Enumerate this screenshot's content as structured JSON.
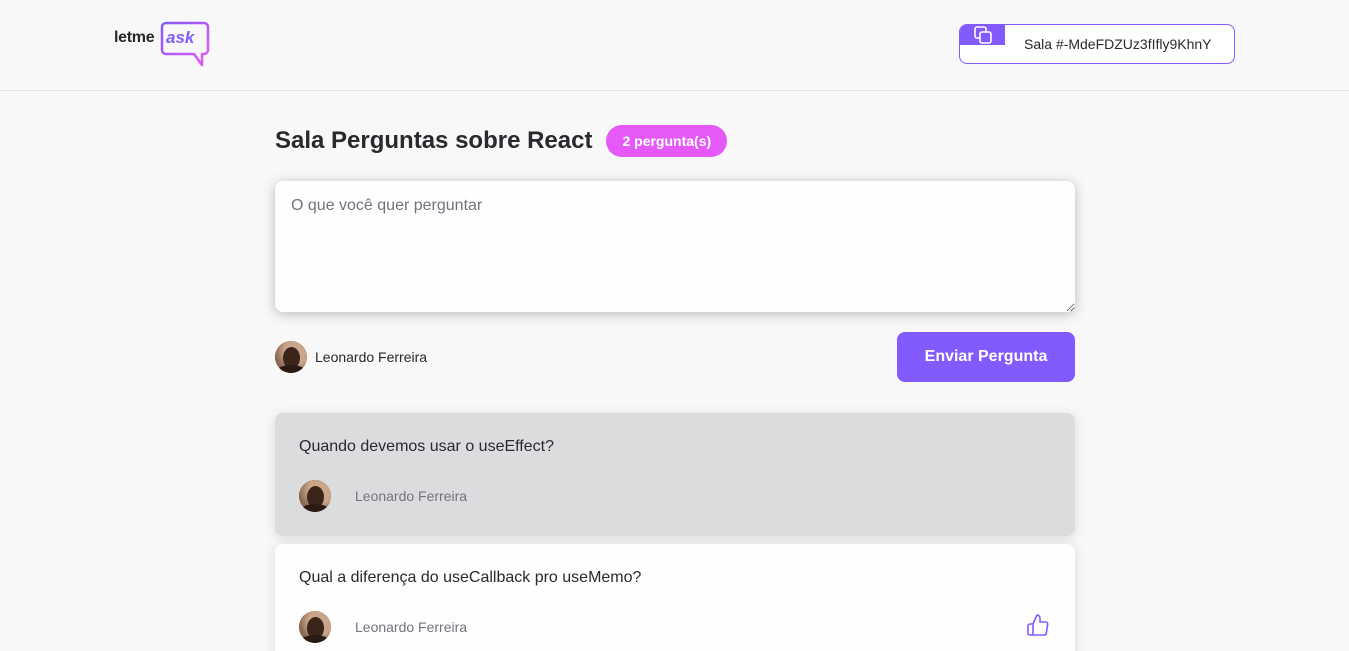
{
  "header": {
    "logo": {
      "text_dark": "letme",
      "text_accent": "ask"
    },
    "room_code": {
      "label": "Sala #-MdeFDZUz3fIfly9KhnY",
      "icon": "copy-icon"
    }
  },
  "room": {
    "title": "Sala Perguntas sobre React",
    "question_count": "2 pergunta(s)"
  },
  "form": {
    "placeholder": "O que você quer perguntar",
    "value": "",
    "user_name": "Leonardo Ferreira",
    "send_label": "Enviar Pergunta"
  },
  "questions": [
    {
      "content": "Quando devemos usar o useEffect?",
      "author": "Leonardo Ferreira",
      "highlighted": true
    },
    {
      "content": "Qual a diferença do useCallback pro useMemo?",
      "author": "Leonardo Ferreira",
      "highlighted": false,
      "icon": "like-icon"
    }
  ],
  "colors": {
    "accent": "#835afd",
    "badge": "#e559f9",
    "background": "#f8f8f8",
    "highlight": "#dbdcdd"
  }
}
